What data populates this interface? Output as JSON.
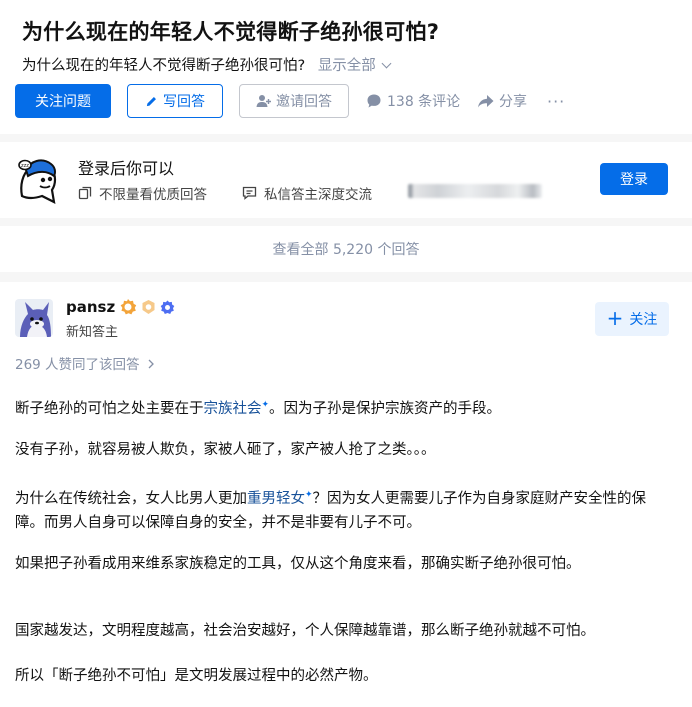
{
  "question": {
    "title": "为什么现在的年轻人不觉得断子绝孙很可怕?",
    "description": "为什么现在的年轻人不觉得断子绝孙很可怕?",
    "show_all": "显示全部"
  },
  "actions": {
    "follow": "关注问题",
    "write": "写回答",
    "invite": "邀请回答",
    "comments": "138 条评论",
    "share": "分享",
    "more": "···"
  },
  "login_prompt": {
    "title": "登录后你可以",
    "feature_1": "不限量看优质回答",
    "feature_2": "私信答主深度交流",
    "login_button": "登录"
  },
  "view_all": "查看全部 5,220 个回答",
  "answer": {
    "author": "pansz",
    "author_sub": "新知答主",
    "follow": "关注",
    "votes": "269 人赞同了该回答",
    "p1_before": "断子绝孙的可怕之处主要在于",
    "p1_link": "宗族社会",
    "p1_after": "。因为子孙是保护宗族资产的手段。",
    "p2": "没有子孙，就容易被人欺负，家被人砸了，家产被人抢了之类。。。",
    "p3_before": "为什么在传统社会，女人比男人更加",
    "p3_link": "重男轻女",
    "p3_after": "？因为女人更需要儿子作为自身家庭财产安全性的保障。而男人自身可以保障自身的安全，并不是非要有儿子不可。",
    "p4": "如果把子孙看成用来维系家族稳定的工具，仅从这个角度来看，那确实断子绝孙很可怕。",
    "p5": "国家越发达，文明程度越高，社会治安越好，个人保障越靠谱，那么断子绝孙就越不可怕。",
    "p6": "所以「断子绝孙不可怕」是文明发展过程中的必然产物。",
    "sparkle": "✦"
  },
  "colors": {
    "brand_blue": "#056de8",
    "link_blue": "#175199",
    "muted_gray": "#8590a6",
    "page_bg": "#f6f6f6"
  },
  "icons": [
    "pen-icon",
    "invite-user-icon",
    "comment-bubble-icon",
    "share-arrow-icon",
    "copy-icon",
    "message-icon",
    "mascot-icon",
    "plus-icon",
    "chevron-right-icon"
  ]
}
